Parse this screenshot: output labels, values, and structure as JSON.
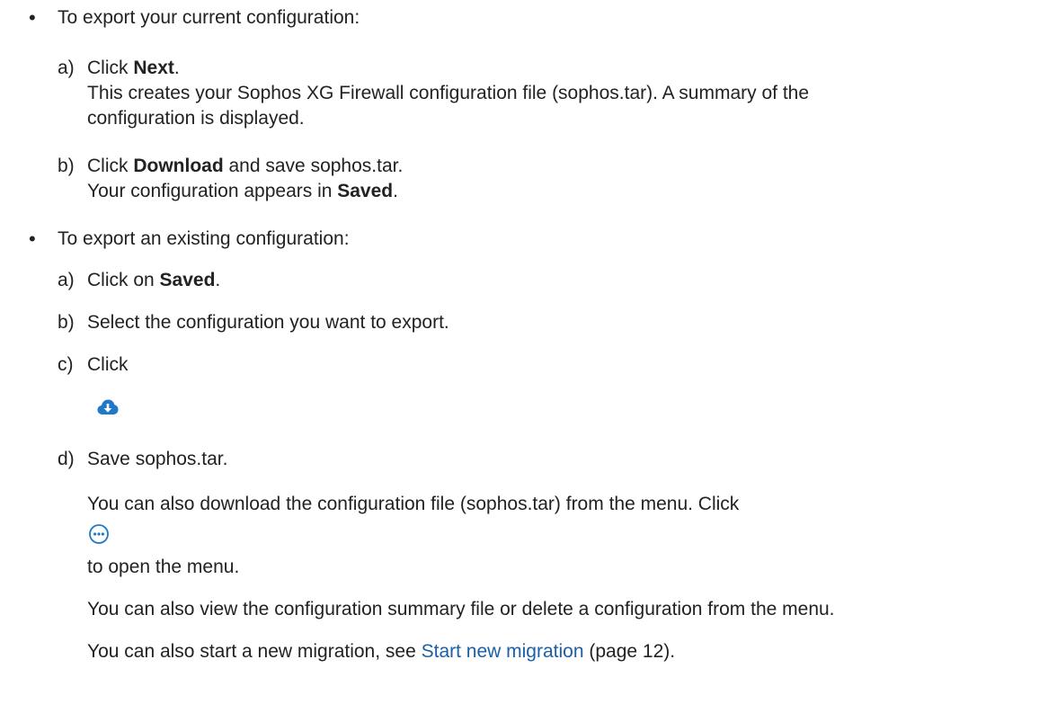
{
  "section_current": {
    "bullet": "•",
    "heading": "To export your current configuration:",
    "step_a": {
      "marker": "a)",
      "pre": "Click ",
      "bold": "Next",
      "post": ".",
      "result_line1": "This creates your Sophos XG Firewall configuration file (sophos.tar). A summary of the",
      "result_line2": "configuration is displayed."
    },
    "step_b": {
      "marker": "b)",
      "pre": "Click ",
      "bold": "Download",
      "post": " and save sophos.tar.",
      "result_pre": "Your configuration appears in ",
      "result_bold": "Saved",
      "result_post": "."
    }
  },
  "section_existing": {
    "bullet": "•",
    "heading": "To export an existing configuration:",
    "step_a": {
      "marker": "a)",
      "pre": "Click on ",
      "bold": "Saved",
      "post": "."
    },
    "step_b": {
      "marker": "b)",
      "text": "Select the configuration you want to export."
    },
    "step_c": {
      "marker": "c)",
      "text": "Click",
      "icon": "cloud-download-icon"
    },
    "step_d": {
      "marker": "d)",
      "text": "Save sophos.tar."
    }
  },
  "notes": {
    "menu_line1": "You can also download the configuration file (sophos.tar) from the menu. Click",
    "menu_icon": "more-options-icon",
    "menu_line2": "to open the menu.",
    "summary_line": "You can also view the configuration summary file or delete a configuration from the menu.",
    "new_migration_pre": "You can also start a new migration, see ",
    "new_migration_link": "Start new migration",
    "new_migration_post": " (page 12)."
  },
  "colors": {
    "text": "#222222",
    "link": "#1a5fa8",
    "icon": "#1f78c8"
  }
}
